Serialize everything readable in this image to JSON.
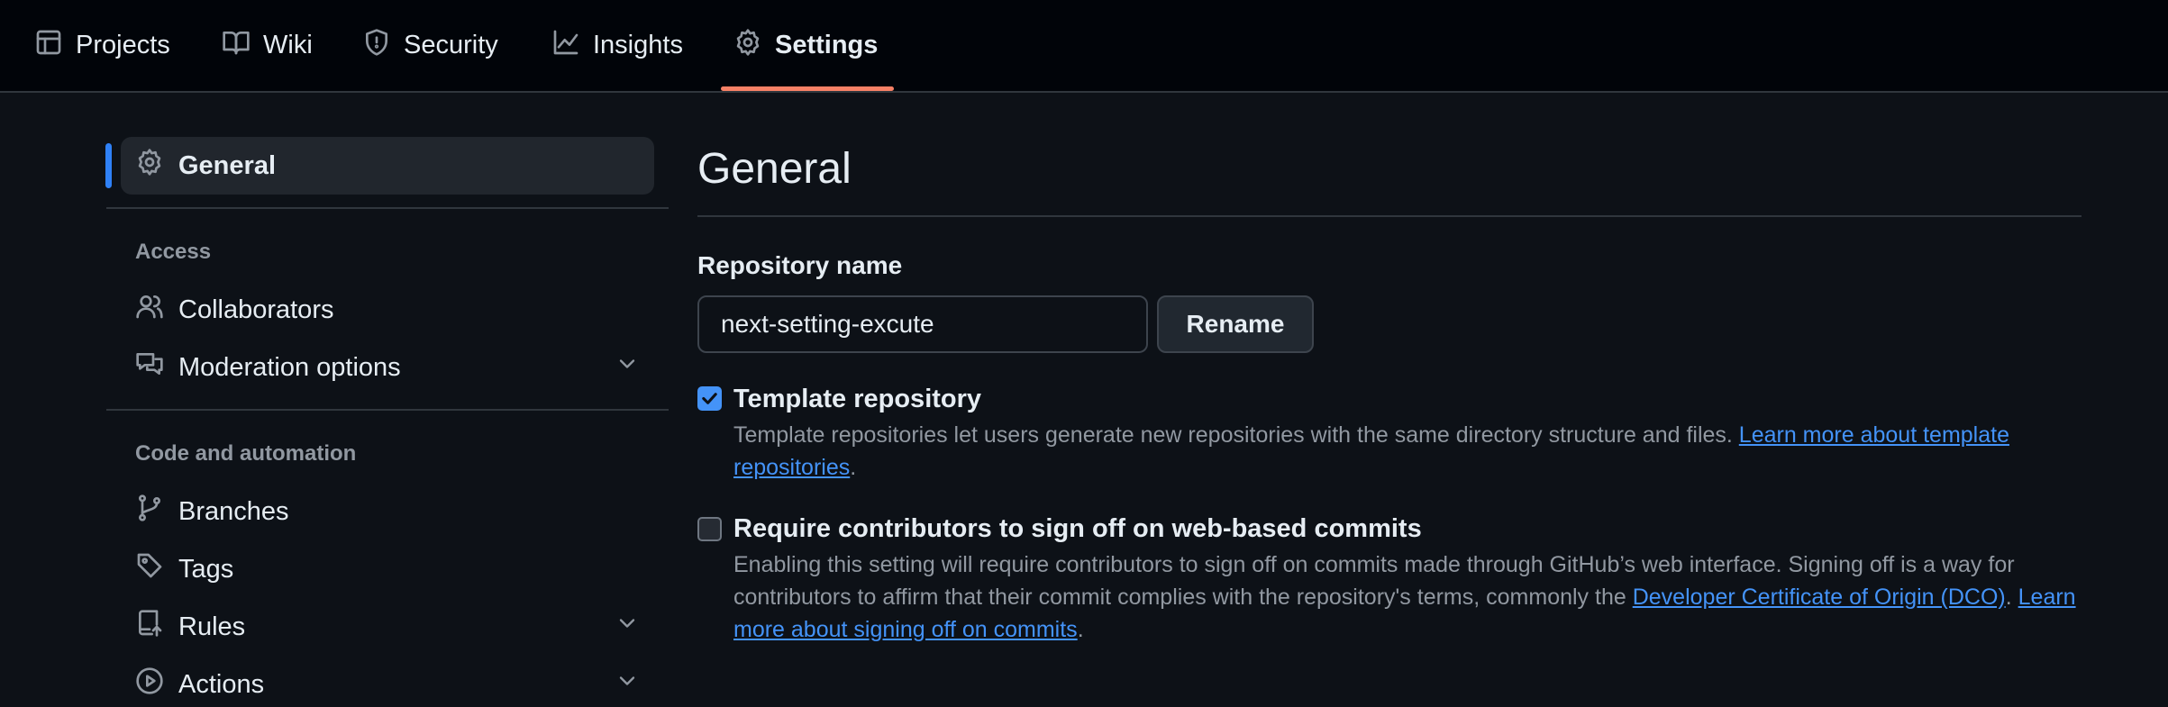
{
  "topnav": {
    "tabs": [
      {
        "label": "Projects",
        "icon": "table-icon"
      },
      {
        "label": "Wiki",
        "icon": "book-icon"
      },
      {
        "label": "Security",
        "icon": "shield-icon"
      },
      {
        "label": "Insights",
        "icon": "graph-icon"
      },
      {
        "label": "Settings",
        "icon": "gear-icon",
        "active": true
      }
    ],
    "active_color": "#f78166"
  },
  "sidebar": {
    "general_label": "General",
    "sections": [
      {
        "heading": "Access",
        "items": [
          {
            "label": "Collaborators",
            "icon": "people-icon",
            "expandable": false
          },
          {
            "label": "Moderation options",
            "icon": "comment-discussion-icon",
            "expandable": true
          }
        ]
      },
      {
        "heading": "Code and automation",
        "items": [
          {
            "label": "Branches",
            "icon": "git-branch-icon",
            "expandable": false
          },
          {
            "label": "Tags",
            "icon": "tag-icon",
            "expandable": false
          },
          {
            "label": "Rules",
            "icon": "repo-push-icon",
            "expandable": true
          },
          {
            "label": "Actions",
            "icon": "play-icon",
            "expandable": true
          }
        ]
      }
    ],
    "indicator_color": "#2f81f7"
  },
  "main": {
    "title": "General",
    "repo_name": {
      "label": "Repository name",
      "value": "next-setting-excute",
      "button_label": "Rename"
    },
    "template": {
      "checked": true,
      "title": "Template repository",
      "desc": "Template repositories let users generate new repositories with the same directory structure and files. ",
      "link": "Learn more about template repositories",
      "end": "."
    },
    "signoff": {
      "checked": false,
      "title": "Require contributors to sign off on web-based commits",
      "desc": "Enabling this setting will require contributors to sign off on commits made through GitHub’s web interface. Signing off is a way for contributors to affirm that their commit complies with the repository's terms, commonly the ",
      "link1": "Developer Certificate of Origin (DCO)",
      "mid": ". ",
      "link2": "Learn more about signing off on commits",
      "end": "."
    },
    "link_color": "#4493f8"
  }
}
